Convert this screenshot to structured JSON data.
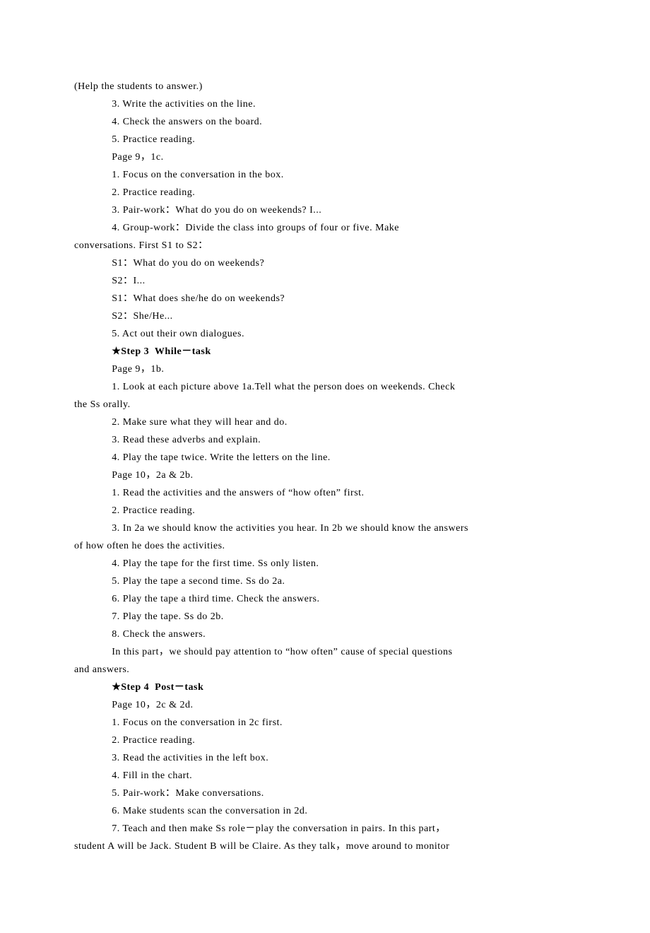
{
  "lines": [
    {
      "cls": "p",
      "text": "(Help the students to answer.)"
    },
    {
      "cls": "p indent",
      "text": "3. Write the activities on the line."
    },
    {
      "cls": "p indent",
      "text": "4. Check the answers on the board."
    },
    {
      "cls": "p indent",
      "text": "5. Practice reading."
    },
    {
      "cls": "p indent",
      "text": "Page 9，1c."
    },
    {
      "cls": "p indent",
      "text": "1. Focus on the conversation in the box."
    },
    {
      "cls": "p indent",
      "text": "2. Practice reading."
    },
    {
      "cls": "p indent",
      "text": "3. Pair-work：What do you do on weekends? I..."
    },
    {
      "cls": "p indent",
      "text": "4. Group-work：Divide the class into groups of four or five. Make"
    },
    {
      "cls": "p",
      "text": "conversations. First S1 to S2："
    },
    {
      "cls": "p indent",
      "text": "S1：What do you do on weekends?"
    },
    {
      "cls": "p indent",
      "text": "S2：I..."
    },
    {
      "cls": "p indent",
      "text": "S1：What does she/he do on weekends?"
    },
    {
      "cls": "p indent",
      "text": "S2：She/He..."
    },
    {
      "cls": "p indent",
      "text": "5. Act out their own dialogues."
    },
    {
      "cls": "p indent bold",
      "text": "★Step 3  While－task"
    },
    {
      "cls": "p indent",
      "text": "Page 9，1b."
    },
    {
      "cls": "p indent",
      "text": "1. Look at each picture above 1a.Tell what the person does on weekends. Check"
    },
    {
      "cls": "p",
      "text": "the Ss orally."
    },
    {
      "cls": "p indent",
      "text": "2. Make sure what they will hear and do."
    },
    {
      "cls": "p indent",
      "text": "3. Read these adverbs and explain."
    },
    {
      "cls": "p indent",
      "text": "4. Play the tape twice. Write the letters on the line."
    },
    {
      "cls": "p indent",
      "text": "Page 10，2a & 2b."
    },
    {
      "cls": "p indent",
      "text": "1. Read the activities and the answers of “how often” first."
    },
    {
      "cls": "p indent",
      "text": "2. Practice reading."
    },
    {
      "cls": "p indent",
      "text": "3. In 2a we should know the activities you hear. In 2b we should know the answers"
    },
    {
      "cls": "p",
      "text": "of how often he does the activities."
    },
    {
      "cls": "p indent",
      "text": "4. Play the tape for the first time. Ss only listen."
    },
    {
      "cls": "p indent",
      "text": "5. Play the tape a second time. Ss do 2a."
    },
    {
      "cls": "p indent",
      "text": "6. Play the tape a third time. Check the answers."
    },
    {
      "cls": "p indent",
      "text": "7. Play the tape. Ss do 2b."
    },
    {
      "cls": "p indent",
      "text": "8. Check the answers."
    },
    {
      "cls": "p indent",
      "text": "In this part，we should pay attention to “how often” cause of special questions"
    },
    {
      "cls": "p",
      "text": "and answers."
    },
    {
      "cls": "p indent bold",
      "text": "★Step 4  Post－task"
    },
    {
      "cls": "p indent",
      "text": "Page 10，2c & 2d."
    },
    {
      "cls": "p indent",
      "text": "1. Focus on the conversation in 2c first."
    },
    {
      "cls": "p indent",
      "text": "2. Practice reading."
    },
    {
      "cls": "p indent",
      "text": "3. Read the activities in the left box."
    },
    {
      "cls": "p indent",
      "text": "4. Fill in the chart."
    },
    {
      "cls": "p indent",
      "text": "5. Pair-work：Make conversations."
    },
    {
      "cls": "p indent",
      "text": "6. Make students scan the conversation in 2d."
    },
    {
      "cls": "p indent",
      "text": "7. Teach and then make Ss role－play the conversation in pairs. In this part，"
    },
    {
      "cls": "p",
      "text": "student A will be Jack. Student B will be Claire. As they talk，move around to monitor"
    }
  ]
}
